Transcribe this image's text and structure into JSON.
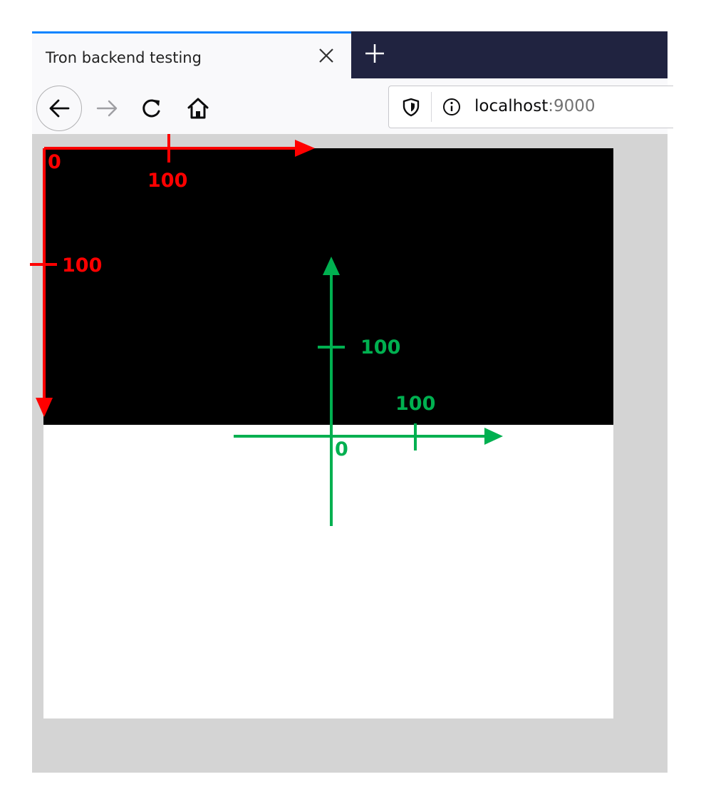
{
  "browser": {
    "tab": {
      "title": "Tron backend testing"
    },
    "toolbar": {
      "back_icon": "arrow-left-icon",
      "forward_icon": "arrow-right-icon",
      "reload_icon": "reload-icon",
      "home_icon": "home-icon"
    },
    "urlbar": {
      "host": "localhost",
      "port": ":9000"
    },
    "colors": {
      "tab_accent": "#0a84ff",
      "tabbar_bg": "#202340",
      "viewport_bg": "#d4d4d4"
    }
  },
  "annotations": {
    "screen_axes": {
      "color": "#ff0000",
      "origin_label": "0",
      "x_tick_label": "100",
      "y_tick_label": "100"
    },
    "world_axes": {
      "color": "#00b050",
      "origin_label": "0",
      "x_tick_label": "100",
      "y_tick_label": "100"
    }
  }
}
